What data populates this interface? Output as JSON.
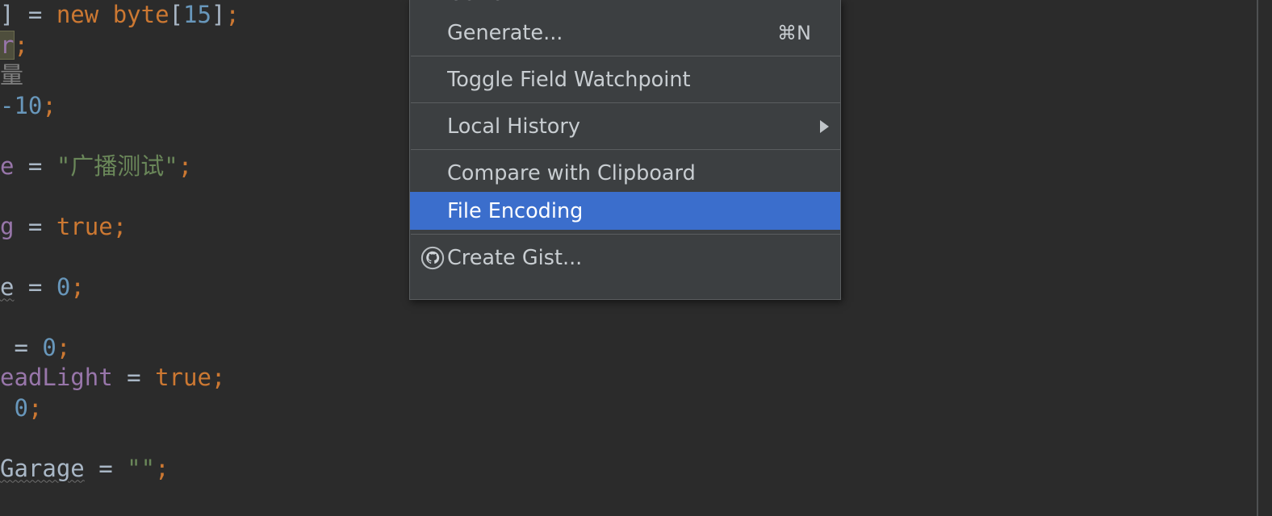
{
  "editor": {
    "background_color": "#2b2b2b",
    "lines": [
      {
        "id": "line-1",
        "tokens": [
          {
            "text": "] ",
            "kind": "punct"
          },
          {
            "text": "= ",
            "kind": "plain"
          },
          {
            "text": "new ",
            "kind": "keyword"
          },
          {
            "text": "byte",
            "kind": "keyword"
          },
          {
            "text": "[",
            "kind": "punct"
          },
          {
            "text": "15",
            "kind": "number"
          },
          {
            "text": "]",
            "kind": "punct"
          },
          {
            "text": ";",
            "kind": "semi"
          }
        ]
      },
      {
        "id": "line-2",
        "tokens": [
          {
            "text": "r",
            "kind": "field",
            "selected": true
          },
          {
            "text": ";",
            "kind": "semi"
          }
        ]
      },
      {
        "id": "line-3",
        "tokens": [
          {
            "text": "量",
            "kind": "comment"
          }
        ]
      },
      {
        "id": "line-4",
        "tokens": [
          {
            "text": "-10",
            "kind": "number"
          },
          {
            "text": ";",
            "kind": "semi"
          }
        ]
      },
      {
        "id": "line-5",
        "tokens": []
      },
      {
        "id": "line-6",
        "tokens": [
          {
            "text": "e ",
            "kind": "field"
          },
          {
            "text": "= ",
            "kind": "plain"
          },
          {
            "text": "\"广播测试\"",
            "kind": "string"
          },
          {
            "text": ";",
            "kind": "semi"
          }
        ]
      },
      {
        "id": "line-7",
        "tokens": []
      },
      {
        "id": "line-8",
        "tokens": [
          {
            "text": "g ",
            "kind": "field"
          },
          {
            "text": "= ",
            "kind": "plain"
          },
          {
            "text": "true",
            "kind": "keyword"
          },
          {
            "text": ";",
            "kind": "semi"
          }
        ]
      },
      {
        "id": "line-9",
        "tokens": []
      },
      {
        "id": "line-10",
        "tokens": [
          {
            "text": "e",
            "kind": "ident",
            "typo": true
          },
          {
            "text": " = ",
            "kind": "plain"
          },
          {
            "text": "0",
            "kind": "number"
          },
          {
            "text": ";",
            "kind": "semi"
          }
        ]
      },
      {
        "id": "line-11",
        "tokens": []
      },
      {
        "id": "line-12",
        "tokens": [
          {
            "text": " = ",
            "kind": "plain"
          },
          {
            "text": "0",
            "kind": "number"
          },
          {
            "text": ";",
            "kind": "semi"
          }
        ]
      },
      {
        "id": "line-13",
        "tokens": [
          {
            "text": "eadLight ",
            "kind": "field"
          },
          {
            "text": "= ",
            "kind": "plain"
          },
          {
            "text": "true",
            "kind": "keyword"
          },
          {
            "text": ";",
            "kind": "semi"
          }
        ]
      },
      {
        "id": "line-14",
        "tokens": [
          {
            "text": " ",
            "kind": "plain"
          },
          {
            "text": "0",
            "kind": "number"
          },
          {
            "text": ";",
            "kind": "semi"
          }
        ]
      },
      {
        "id": "line-15",
        "tokens": []
      },
      {
        "id": "line-16",
        "tokens": [
          {
            "text": "Garage",
            "kind": "ident",
            "typo": true
          },
          {
            "text": " = ",
            "kind": "plain"
          },
          {
            "text": "\"\"",
            "kind": "string"
          },
          {
            "text": ";",
            "kind": "semi"
          }
        ]
      }
    ]
  },
  "context_menu": {
    "background_color": "#3c3f41",
    "highlight_color": "#3b6ecc",
    "items": [
      {
        "id": "go-to",
        "label": "Go To",
        "accel": "",
        "submenu": true,
        "icon": "",
        "selected": false,
        "clipped": true
      },
      {
        "id": "generate",
        "label": "Generate...",
        "accel": "⌘N",
        "submenu": false,
        "icon": "",
        "selected": false
      },
      {
        "id": "separator-1",
        "separator": true
      },
      {
        "id": "toggle-field-watchpoint",
        "label": "Toggle Field Watchpoint",
        "accel": "",
        "submenu": false,
        "icon": "",
        "selected": false
      },
      {
        "id": "separator-2",
        "separator": true
      },
      {
        "id": "local-history",
        "label": "Local History",
        "accel": "",
        "submenu": true,
        "icon": "",
        "selected": false
      },
      {
        "id": "separator-3",
        "separator": true
      },
      {
        "id": "compare-with-clipboard",
        "label": "Compare with Clipboard",
        "accel": "",
        "submenu": false,
        "icon": "",
        "selected": false
      },
      {
        "id": "file-encoding",
        "label": "File Encoding",
        "accel": "",
        "submenu": false,
        "icon": "",
        "selected": true
      },
      {
        "id": "separator-4",
        "separator": true
      },
      {
        "id": "create-gist",
        "label": "Create Gist...",
        "accel": "",
        "submenu": false,
        "icon": "github-octocat-icon",
        "selected": false
      }
    ]
  }
}
